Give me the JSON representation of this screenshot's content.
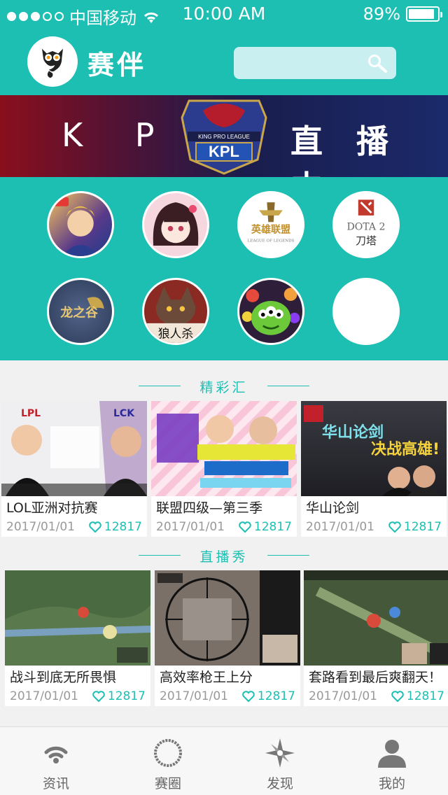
{
  "status_bar": {
    "carrier": "中国移动",
    "time": "10:00 AM",
    "battery": "89%",
    "battery_level": 0.89
  },
  "header": {
    "app_title": "赛伴",
    "search_placeholder": ""
  },
  "banner": {
    "left_text": "K P L",
    "right_text": "直 播 中"
  },
  "categories": [
    {
      "icon": "hero-portrait-icon",
      "label": ""
    },
    {
      "icon": "anime-girl-icon",
      "label": ""
    },
    {
      "icon": "league-of-legends-icon",
      "label": "英雄联盟"
    },
    {
      "icon": "dota2-icon",
      "label": "DOTA 2 刀塔"
    },
    {
      "icon": "dragon-valley-icon",
      "label": "龙之谷"
    },
    {
      "icon": "werewolf-icon",
      "label": "狼人杀"
    },
    {
      "icon": "green-monster-icon",
      "label": ""
    },
    {
      "icon": "empty-slot-icon",
      "label": ""
    }
  ],
  "sections": {
    "highlights": {
      "title": "精彩汇",
      "cards": [
        {
          "title": "LOL亚洲对抗赛",
          "date": "2017/01/01",
          "likes": "12817"
        },
        {
          "title": "联盟四级—第三季",
          "date": "2017/01/01",
          "likes": "12817"
        },
        {
          "title": "华山论剑",
          "date": "2017/01/01",
          "likes": "12817"
        }
      ]
    },
    "live_show": {
      "title": "直播秀",
      "cards": [
        {
          "title": "战斗到底无所畏惧",
          "date": "2017/01/01",
          "likes": "12817"
        },
        {
          "title": "高效率枪王上分",
          "date": "2017/01/01",
          "likes": "12817"
        },
        {
          "title": "套路看到最后爽翻天！",
          "date": "2017/01/01",
          "likes": "12817"
        }
      ]
    }
  },
  "tabbar": [
    {
      "label": "资讯",
      "icon": "wifi-news-icon"
    },
    {
      "label": "赛圈",
      "icon": "circle-icon"
    },
    {
      "label": "发现",
      "icon": "compass-icon"
    },
    {
      "label": "我的",
      "icon": "user-icon"
    }
  ],
  "colors": {
    "accent": "#1dbfb3",
    "search_bg": "#c9eff0"
  }
}
